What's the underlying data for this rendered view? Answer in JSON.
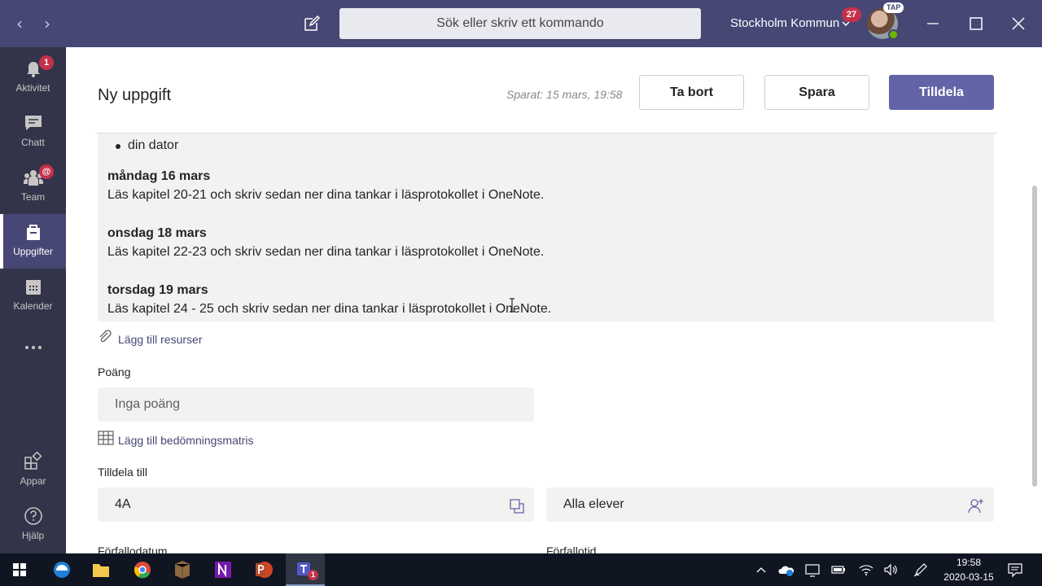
{
  "titlebar": {
    "search_placeholder": "Sök eller skriv ett kommando",
    "org_name": "Stockholm Kommun",
    "org_badge": "27",
    "avatar_tag": "TAP"
  },
  "rail": {
    "items": [
      {
        "label": "Aktivitet",
        "badge": "1",
        "icon": "bell-icon"
      },
      {
        "label": "Chatt",
        "icon": "chat-icon"
      },
      {
        "label": "Team",
        "badge": "@",
        "icon": "team-icon"
      },
      {
        "label": "Uppgifter",
        "icon": "assignments-icon",
        "active": true
      },
      {
        "label": "Kalender",
        "icon": "calendar-icon"
      },
      {
        "label": "",
        "icon": "more-icon"
      },
      {
        "label": "Appar",
        "icon": "apps-icon"
      },
      {
        "label": "Hjälp",
        "icon": "help-icon"
      }
    ]
  },
  "header": {
    "title": "Ny uppgift",
    "saved": "Sparat: 15 mars, 19:58",
    "delete_label": "Ta bort",
    "save_label": "Spara",
    "assign_label": "Tilldela"
  },
  "instructions": {
    "bullet": "din dator",
    "days": [
      {
        "title": "måndag 16 mars",
        "text": "Läs kapitel 20-21 och skriv sedan ner dina tankar i läsprotokollet i OneNote."
      },
      {
        "title": "onsdag 18 mars",
        "text": "Läs kapitel 22-23 och skriv sedan ner dina tankar i läsprotokollet i OneNote."
      },
      {
        "title": "torsdag 19 mars",
        "text": "Läs kapitel 24 - 25 och skriv sedan ner dina tankar i läsprotokollet i OneNote."
      }
    ]
  },
  "resources": {
    "add_label": "Lägg till resurser"
  },
  "points": {
    "label": "Poäng",
    "placeholder": "Inga poäng"
  },
  "rubric": {
    "add_label": "Lägg till bedömningsmatris"
  },
  "assign_to": {
    "label": "Tilldela till",
    "class_value": "4A",
    "students_value": "Alla elever"
  },
  "due": {
    "date_label": "Förfallodatum",
    "time_label": "Förfallotid"
  },
  "taskbar": {
    "time": "19:58",
    "date": "2020-03-15",
    "teams_badge": "1"
  },
  "colors": {
    "titlebar": "#464775",
    "rail": "#33344a",
    "accent": "#6264a7",
    "badge": "#c4314b"
  }
}
